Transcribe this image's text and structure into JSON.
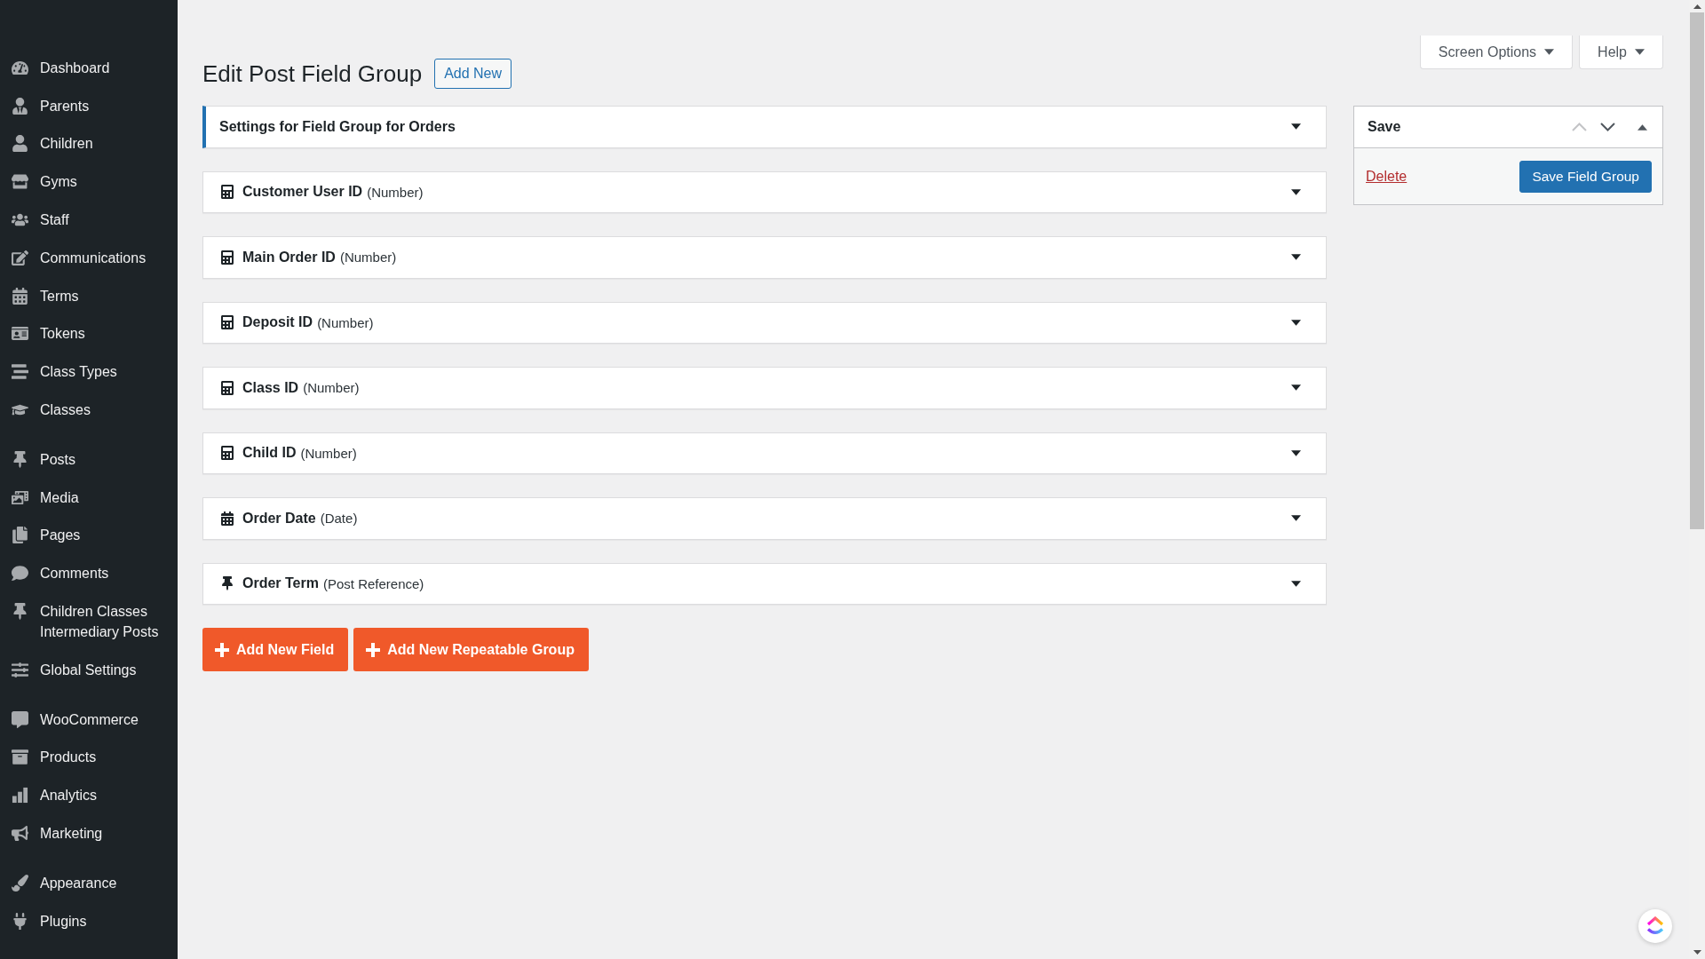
{
  "sidebar": {
    "groups": [
      {
        "items": [
          {
            "label": "Dashboard",
            "selected": false
          },
          {
            "label": "Parents",
            "selected": false
          },
          {
            "label": "Children",
            "selected": false
          },
          {
            "label": "Gyms",
            "selected": false
          },
          {
            "label": "Staff",
            "selected": false
          },
          {
            "label": "Communications",
            "selected": false
          },
          {
            "label": "Terms",
            "selected": false
          },
          {
            "label": "Tokens",
            "selected": false
          },
          {
            "label": "Class Types",
            "selected": false
          },
          {
            "label": "Classes",
            "selected": false
          }
        ]
      },
      {
        "items": [
          {
            "label": "Posts",
            "selected": false
          },
          {
            "label": "Media",
            "selected": false
          },
          {
            "label": "Pages",
            "selected": false
          },
          {
            "label": "Comments",
            "selected": false
          },
          {
            "label": "Children Classes Intermediary Posts",
            "selected": false
          },
          {
            "label": "Global Settings",
            "selected": false
          }
        ]
      },
      {
        "items": [
          {
            "label": "WooCommerce",
            "selected": false
          },
          {
            "label": "Products",
            "selected": false
          },
          {
            "label": "Analytics",
            "selected": false
          },
          {
            "label": "Marketing",
            "selected": false
          }
        ]
      },
      {
        "items": [
          {
            "label": "Appearance",
            "selected": false
          },
          {
            "label": "Plugins",
            "selected": false
          }
        ]
      }
    ]
  },
  "screen_meta": [
    {
      "label": "Screen Options",
      "expanded": false
    },
    {
      "label": "Help",
      "expanded": false
    }
  ],
  "header": {
    "title": "Edit Post Field Group",
    "add_new": "Add New"
  },
  "settings_panel": {
    "title": "Settings for Field Group for Orders",
    "expanded": false
  },
  "fields": [
    {
      "name": "Customer User ID",
      "type": "(Number)",
      "kind": "number",
      "expanded": false
    },
    {
      "name": "Main Order ID",
      "type": "(Number)",
      "kind": "number",
      "expanded": false
    },
    {
      "name": "Deposit ID",
      "type": "(Number)",
      "kind": "number",
      "expanded": false
    },
    {
      "name": "Class ID",
      "type": "(Number)",
      "kind": "number",
      "expanded": false
    },
    {
      "name": "Child ID",
      "type": "(Number)",
      "kind": "number",
      "expanded": false
    },
    {
      "name": "Order Date",
      "type": "(Date)",
      "kind": "date",
      "expanded": false
    },
    {
      "name": "Order Term",
      "type": "(Post Reference)",
      "kind": "post_reference",
      "expanded": false
    }
  ],
  "actions": [
    "Add New Field",
    "Add New Repeatable Group"
  ],
  "save_box": {
    "title": "Save",
    "expanded": true,
    "move_buttons": [
      {
        "kind": "up",
        "disabled": true
      },
      {
        "kind": "down",
        "disabled": false
      }
    ],
    "delete": "Delete",
    "submit": "Save Field Group"
  }
}
